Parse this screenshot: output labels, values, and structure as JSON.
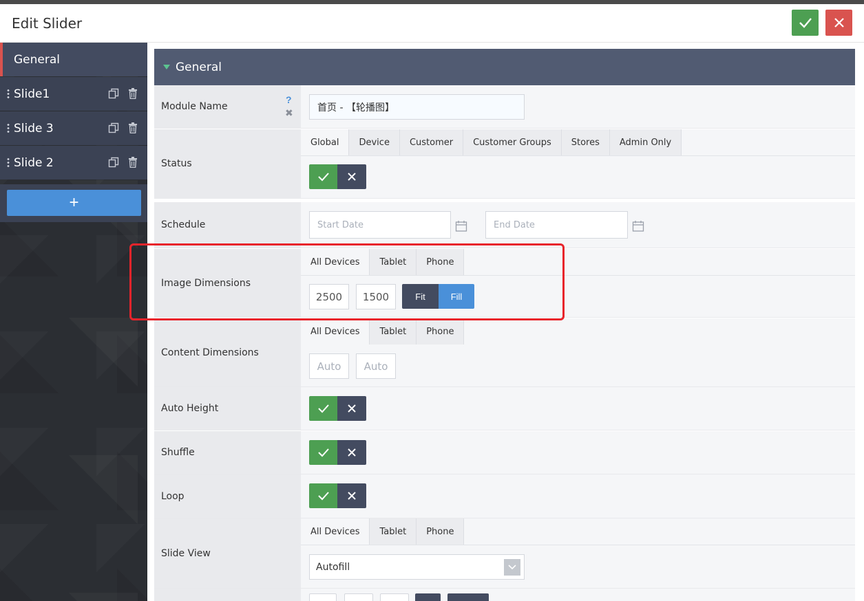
{
  "modal": {
    "title": "Edit Slider"
  },
  "sidebar": {
    "items": [
      {
        "label": "General"
      },
      {
        "label": "Slide1"
      },
      {
        "label": "Slide 3"
      },
      {
        "label": "Slide 2"
      }
    ],
    "add_label": "+"
  },
  "section": {
    "title": "General"
  },
  "fields": {
    "module_name": {
      "label": "Module Name",
      "value": "首页 - 【轮播图】",
      "help": "?"
    },
    "status": {
      "label": "Status"
    },
    "schedule": {
      "label": "Schedule",
      "start_placeholder": "Start Date",
      "end_placeholder": "End Date"
    },
    "image_dimensions": {
      "label": "Image Dimensions",
      "width": "2500",
      "height": "1500",
      "fit_label": "Fit",
      "fill_label": "Fill",
      "selected": "Fill"
    },
    "content_dimensions": {
      "label": "Content Dimensions",
      "width_placeholder": "Auto",
      "height_placeholder": "Auto"
    },
    "auto_height": {
      "label": "Auto Height"
    },
    "shuffle": {
      "label": "Shuffle"
    },
    "loop": {
      "label": "Loop"
    },
    "slide_view": {
      "label": "Slide View",
      "value": "Autofill"
    }
  },
  "status_tabs": [
    "Global",
    "Device",
    "Customer",
    "Customer Groups",
    "Stores",
    "Admin Only"
  ],
  "device_tabs": [
    "All Devices",
    "Tablet",
    "Phone"
  ],
  "colors": {
    "accent": "#4a90d9",
    "success": "#4d9f52",
    "danger": "#d9534f",
    "section_header": "#515b72",
    "highlight": "#e8242b"
  }
}
